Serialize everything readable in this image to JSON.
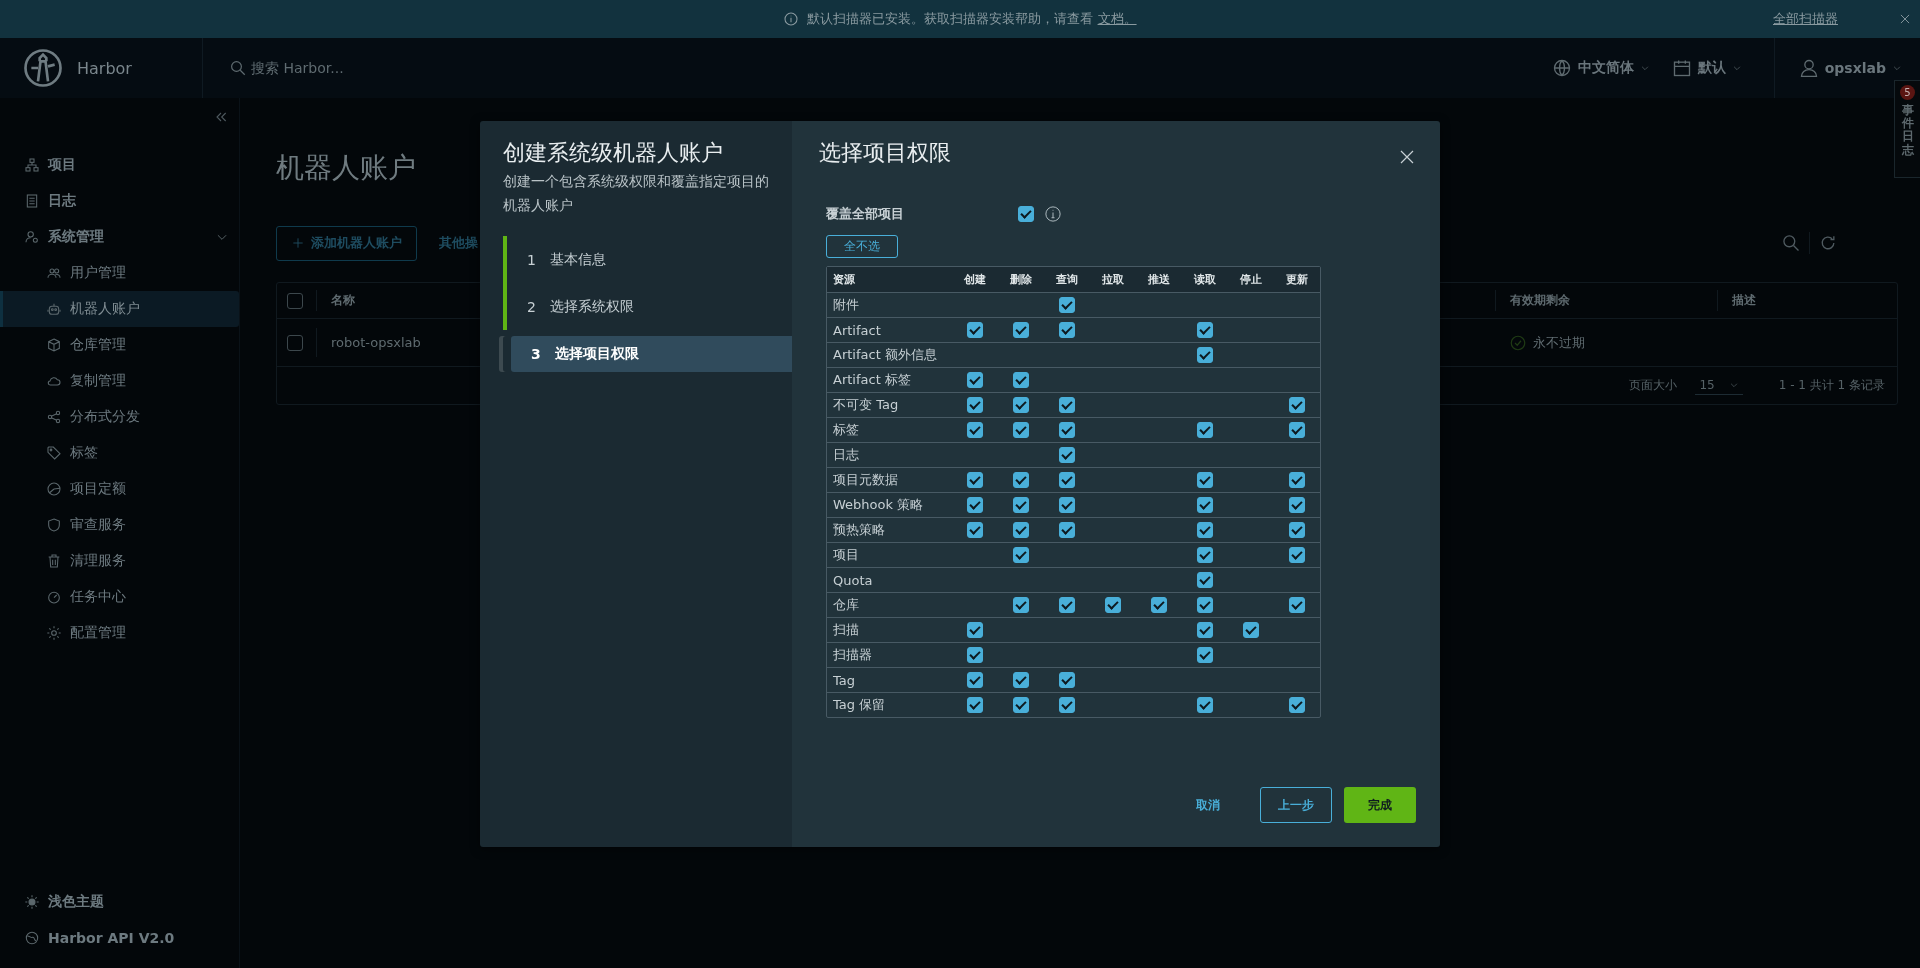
{
  "banner": {
    "message": "默认扫描器已安装。获取扫描器安装帮助，请查看 ",
    "link": "文档。",
    "action": "全部扫描器"
  },
  "header": {
    "brand": "Harbor",
    "search": {
      "placeholder": "搜索 Harbor..."
    },
    "language": "中文简体",
    "date_format": "默认",
    "user": "opsxlab"
  },
  "event_log": {
    "label": "事件日志",
    "count": "5"
  },
  "sidebar": {
    "items": [
      {
        "label": "项目",
        "selected": false
      },
      {
        "label": "日志",
        "selected": false
      },
      {
        "label": "系统管理",
        "selected": false,
        "expanded": true,
        "children": [
          {
            "label": "用户管理",
            "selected": false
          },
          {
            "label": "机器人账户",
            "selected": true
          },
          {
            "label": "仓库管理",
            "selected": false
          },
          {
            "label": "复制管理",
            "selected": false
          },
          {
            "label": "分布式分发",
            "selected": false
          },
          {
            "label": "标签",
            "selected": false
          },
          {
            "label": "项目定额",
            "selected": false
          },
          {
            "label": "审查服务",
            "selected": false
          },
          {
            "label": "清理服务",
            "selected": false
          },
          {
            "label": "任务中心",
            "selected": false
          },
          {
            "label": "配置管理",
            "selected": false
          }
        ]
      }
    ],
    "footer": [
      "浅色主题",
      "Harbor API V2.0"
    ]
  },
  "page": {
    "title": "机器人账户",
    "add_button": "添加机器人账户",
    "other_actions": "其他操",
    "table": {
      "select_all": false,
      "columns": [
        "名称",
        "有效期剩余",
        "描述"
      ],
      "rows": [
        {
          "name": "robot-opsxlab",
          "expiry": "永不过期",
          "selected": false
        }
      ],
      "page_size_label": "页面大小",
      "page_size": "15",
      "summary": "1 - 1 共计 1 条记录"
    }
  },
  "modal": {
    "title": "创建系统级机器人账户",
    "subtitle": "创建一个包含系统级权限和覆盖指定项目的机器人账户",
    "steps": [
      {
        "number": "1",
        "label": "基本信息",
        "done": true,
        "selected": false
      },
      {
        "number": "2",
        "label": "选择系统权限",
        "done": true,
        "selected": false
      },
      {
        "number": "3",
        "label": "选择项目权限",
        "done": false,
        "selected": true
      }
    ],
    "panel_title": "选择项目权限",
    "cover_all": {
      "label": "覆盖全部项目",
      "checked": true
    },
    "deselect_all": "全不选",
    "permissions": {
      "columns": [
        "资源",
        "创建",
        "删除",
        "查询",
        "拉取",
        "推送",
        "读取",
        "停止",
        "更新"
      ],
      "rows": [
        {
          "resource": "附件",
          "checks": [
            false,
            false,
            true,
            false,
            false,
            false,
            false,
            false
          ]
        },
        {
          "resource": "Artifact",
          "checks": [
            true,
            true,
            true,
            false,
            false,
            true,
            false,
            false
          ]
        },
        {
          "resource": "Artifact 额外信息",
          "checks": [
            false,
            false,
            false,
            false,
            false,
            true,
            false,
            false
          ]
        },
        {
          "resource": "Artifact 标签",
          "checks": [
            true,
            true,
            false,
            false,
            false,
            false,
            false,
            false
          ]
        },
        {
          "resource": "不可变 Tag",
          "checks": [
            true,
            true,
            true,
            false,
            false,
            false,
            false,
            true
          ]
        },
        {
          "resource": "标签",
          "checks": [
            true,
            true,
            true,
            false,
            false,
            true,
            false,
            true
          ]
        },
        {
          "resource": "日志",
          "checks": [
            false,
            false,
            true,
            false,
            false,
            false,
            false,
            false
          ]
        },
        {
          "resource": "项目元数据",
          "checks": [
            true,
            true,
            true,
            false,
            false,
            true,
            false,
            true
          ]
        },
        {
          "resource": "Webhook 策略",
          "checks": [
            true,
            true,
            true,
            false,
            false,
            true,
            false,
            true
          ]
        },
        {
          "resource": "预热策略",
          "checks": [
            true,
            true,
            true,
            false,
            false,
            true,
            false,
            true
          ]
        },
        {
          "resource": "项目",
          "checks": [
            false,
            true,
            false,
            false,
            false,
            true,
            false,
            true
          ]
        },
        {
          "resource": "Quota",
          "checks": [
            false,
            false,
            false,
            false,
            false,
            true,
            false,
            false
          ]
        },
        {
          "resource": "仓库",
          "checks": [
            false,
            true,
            true,
            true,
            true,
            true,
            false,
            true
          ]
        },
        {
          "resource": "扫描",
          "checks": [
            true,
            false,
            false,
            false,
            false,
            true,
            true,
            false
          ]
        },
        {
          "resource": "扫描器",
          "checks": [
            true,
            false,
            false,
            false,
            false,
            true,
            false,
            false
          ]
        },
        {
          "resource": "Tag",
          "checks": [
            true,
            true,
            true,
            false,
            false,
            false,
            false,
            false
          ]
        },
        {
          "resource": "Tag 保留",
          "checks": [
            true,
            true,
            true,
            false,
            false,
            true,
            false,
            true
          ]
        }
      ]
    },
    "buttons": {
      "cancel": "取消",
      "back": "上一步",
      "finish": "完成"
    }
  }
}
